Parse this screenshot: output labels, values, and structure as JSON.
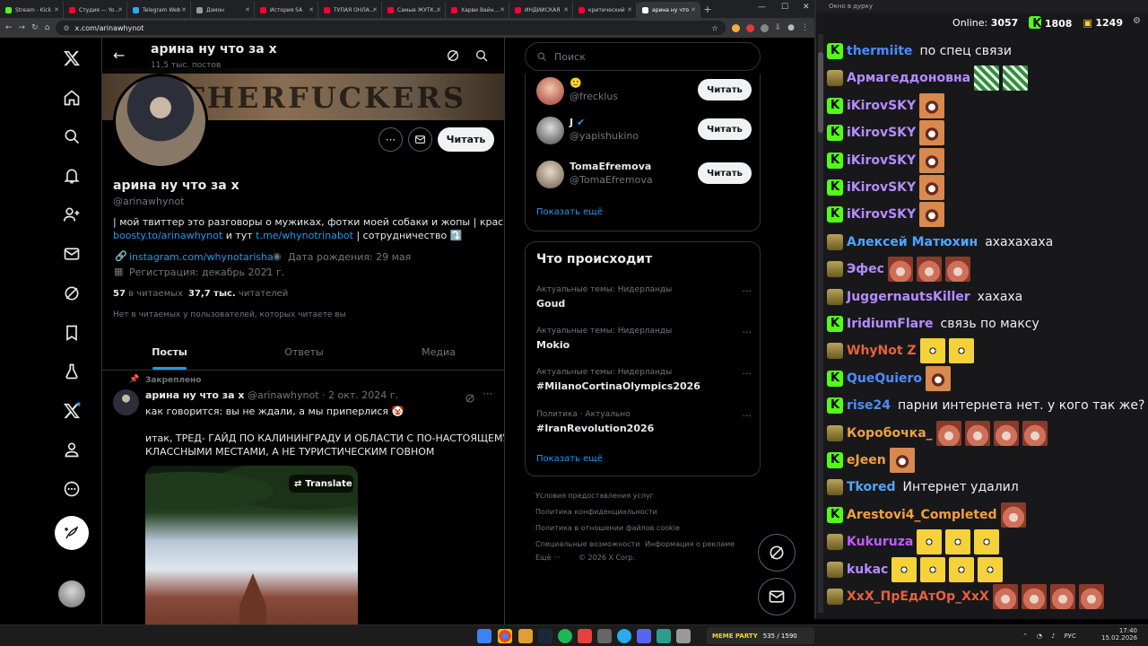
{
  "browser": {
    "tabs": [
      {
        "label": "Stream - Kick",
        "color": "#53fc18"
      },
      {
        "label": "Студия — YouTube",
        "color": "#ff0033"
      },
      {
        "label": "Telegram Web",
        "color": "#2aabee"
      },
      {
        "label": "Дэмон",
        "color": "#9a9a9a"
      },
      {
        "label": "История SA",
        "color": "#ff0033"
      },
      {
        "label": "ТУПАЯ ОНЛАЙН",
        "color": "#ff0033"
      },
      {
        "label": "Самые ЖУТКИЕ",
        "color": "#ff0033"
      },
      {
        "label": "Харви Вайнштейн",
        "color": "#ff0033"
      },
      {
        "label": "ИНДИЙСКАЯ",
        "color": "#ff0033"
      },
      {
        "label": "критический",
        "color": "#ff0033"
      },
      {
        "label": "арина ну что",
        "color": "#ffffff"
      }
    ],
    "url": "x.com/arinawhynot"
  },
  "profile": {
    "header_name": "арина ну что за х",
    "header_posts": "11,5 тыс. постов",
    "banner_text": "THERFUCKERS",
    "follow_label": "Читать",
    "display_name": "арина ну что за х",
    "handle": "@arinawhynot",
    "bio_1": "| мой твиттер это разговоры о мужиках, фотки моей собаки и жопы | красивое тут",
    "bio_link_1": "boosty.to/arinawhynot",
    "bio_mid": " и тут ",
    "bio_link_2": "t.me/whynotrinabot",
    "bio_end": " | сотрудничество ⤵️",
    "website": "instagram.com/whynotarisha",
    "birthday": "Дата рождения: 29 мая",
    "joined": "Регистрация: декабрь 2021 г.",
    "following_count": "57",
    "following_label": "в читаемых",
    "followers_count": "37,7 тыс.",
    "followers_label": "читателей",
    "no_common": "Нет в читаемых у пользователей, которых читаете вы",
    "tabs": [
      "Посты",
      "Ответы",
      "Медиа"
    ]
  },
  "post": {
    "pinned_label": "Закреплено",
    "author": "арина ну что за х",
    "handle_date": "@arinawhynot · 2 окт. 2024 г.",
    "line1": "как говорится: вы не ждали, а мы приперлися 🤡",
    "line2": "итак, ТРЕД- ГАЙД ПО КАЛИНИНГРАДУ И ОБЛАСТИ С ПО-НАСТОЯЩЕМУ",
    "line3": "КЛАССНЫМИ МЕСТАМИ, А НЕ ТУРИСТИЧЕСКИМ ГОВНОМ",
    "translate_label": "Translate"
  },
  "sidebar": {
    "search_placeholder": "Поиск",
    "who_to_follow": [
      {
        "name": "🙂",
        "handle": "@frecklus",
        "follow": "Читать"
      },
      {
        "name": "J",
        "handle": "@yapishukino",
        "follow": "Читать"
      },
      {
        "name": "TomaEfremova",
        "handle": "@TomaEfremova",
        "follow": "Читать"
      }
    ],
    "show_more": "Показать ещё",
    "trends_title": "Что происходит",
    "trends": [
      {
        "category": "Актуальные темы: Нидерланды",
        "name": "Goud"
      },
      {
        "category": "Актуальные темы: Нидерланды",
        "name": "Mokio"
      },
      {
        "category": "Актуальные темы: Нидерланды",
        "name": "#MilanoCortinaOlympics2026"
      },
      {
        "category": "Политика · Актуально",
        "name": "#IranRevolution2026"
      }
    ],
    "trends_show_more": "Показать ещё",
    "footer": [
      "Условия предоставления услуг",
      "Политика конфиденциальности",
      "Политика в отношении файлов cookie",
      "Специальные возможности",
      "Информация о рекламе",
      "Ещё ···",
      "© 2026 X Corp."
    ]
  },
  "chat": {
    "window_title": "Окно в дурку",
    "online_label": "Online:",
    "online_count": "3057",
    "kick_count": "1808",
    "gift_count": "1249",
    "messages": [
      {
        "user": "thermiite",
        "color": "#4d8cff",
        "text": "по спец связи",
        "emotes": []
      },
      {
        "user": "Армагеддоновна",
        "color": "#b58cff",
        "text": "",
        "emotes": [
          "em-green",
          "em-green"
        ]
      },
      {
        "user": "iKirovSKY",
        "color": "#b58cff",
        "text": "",
        "emotes": [
          "em-grin"
        ]
      },
      {
        "user": "iKirovSKY",
        "color": "#b58cff",
        "text": "",
        "emotes": [
          "em-grin"
        ]
      },
      {
        "user": "iKirovSKY",
        "color": "#b58cff",
        "text": "",
        "emotes": [
          "em-grin"
        ]
      },
      {
        "user": "iKirovSKY",
        "color": "#b58cff",
        "text": "",
        "emotes": [
          "em-grin"
        ]
      },
      {
        "user": "iKirovSKY",
        "color": "#b58cff",
        "text": "",
        "emotes": [
          "em-grin"
        ]
      },
      {
        "user": "Алексей Матюхин",
        "color": "#4da6ff",
        "text": "ахахахаха",
        "emotes": []
      },
      {
        "user": "Эфес",
        "color": "#b58cff",
        "text": "",
        "emotes": [
          "em-face",
          "em-face",
          "em-face"
        ]
      },
      {
        "user": "JuggernautsKiller",
        "color": "#b58cff",
        "text": "хахаха",
        "emotes": []
      },
      {
        "user": "IridiumFlare",
        "color": "#b58cff",
        "text": "связь по максу",
        "emotes": []
      },
      {
        "user": "WhyNot Z",
        "color": "#e8613c",
        "text": "",
        "emotes": [
          "em-yellow",
          "em-yellow"
        ]
      },
      {
        "user": "QueQuiero",
        "color": "#4d8cff",
        "text": "",
        "emotes": [
          "em-grin"
        ]
      },
      {
        "user": "rise24",
        "color": "#4d8cff",
        "text": "парни интернета нет. у кого так же?",
        "emotes": []
      },
      {
        "user": "Коробочка_",
        "color": "#f0a040",
        "text": "",
        "emotes": [
          "em-face",
          "em-face",
          "em-face",
          "em-face"
        ]
      },
      {
        "user": "eJeen",
        "color": "#f0a040",
        "text": "",
        "emotes": [
          "em-grin"
        ]
      },
      {
        "user": "Tkored",
        "color": "#4da6ff",
        "text": "Интернет удалил",
        "emotes": []
      },
      {
        "user": "Arestovi4_Completed",
        "color": "#f0a040",
        "text": "",
        "emotes": [
          "em-face"
        ]
      },
      {
        "user": "Kukuruza",
        "color": "#c05cff",
        "text": "",
        "emotes": [
          "em-yellow",
          "em-yellow",
          "em-yellow"
        ]
      },
      {
        "user": "kukac",
        "color": "#b58cff",
        "text": "",
        "emotes": [
          "em-yellow",
          "em-yellow",
          "em-yellow",
          "em-yellow"
        ]
      },
      {
        "user": "XxX_ПрЕдАтОр_XxX",
        "color": "#e8613c",
        "text": "",
        "emotes": [
          "em-face",
          "em-face",
          "em-face",
          "em-face"
        ]
      }
    ]
  },
  "taskbar": {
    "widget_text": "MEME PARTY",
    "widget_counter": "535 / 1590",
    "lang": "РУС",
    "time": "17:40",
    "date": "15.02.2026"
  }
}
